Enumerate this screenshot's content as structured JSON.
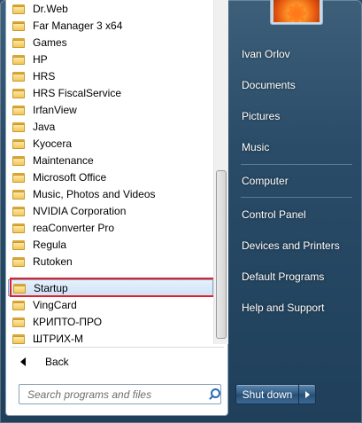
{
  "programs": {
    "items": [
      {
        "label": "Dr.Web"
      },
      {
        "label": "Far Manager 3 x64"
      },
      {
        "label": "Games"
      },
      {
        "label": "HP"
      },
      {
        "label": "HRS"
      },
      {
        "label": "HRS FiscalService"
      },
      {
        "label": "IrfanView"
      },
      {
        "label": "Java"
      },
      {
        "label": "Kyocera"
      },
      {
        "label": "Maintenance"
      },
      {
        "label": "Microsoft Office"
      },
      {
        "label": "Music, Photos and Videos"
      },
      {
        "label": "NVIDIA Corporation"
      },
      {
        "label": "reaConverter Pro"
      },
      {
        "label": "Regula"
      },
      {
        "label": "Rutoken"
      },
      {
        "label": "Startup"
      },
      {
        "label": "VingCard"
      },
      {
        "label": "КРИПТО-ПРО"
      },
      {
        "label": "ШТРИХ-М"
      }
    ],
    "highlighted_label": "Startup",
    "back_label": "Back",
    "icon": "folder-icon"
  },
  "search": {
    "placeholder": "Search programs and files",
    "icon": "search-icon"
  },
  "user": {
    "name": "Ivan Orlov",
    "avatar": "flower-avatar"
  },
  "right_links": [
    {
      "label": "Ivan Orlov"
    },
    {
      "label": "Documents"
    },
    {
      "label": "Pictures"
    },
    {
      "label": "Music"
    },
    {
      "label": "Computer"
    },
    {
      "label": "Control Panel"
    },
    {
      "label": "Devices and Printers"
    },
    {
      "label": "Default Programs"
    },
    {
      "label": "Help and Support"
    }
  ],
  "shutdown": {
    "label": "Shut down",
    "arrow_icon": "arrow-right-icon"
  },
  "colors": {
    "highlight_border": "#e0202a",
    "menu_blue": "#2a4c68"
  }
}
